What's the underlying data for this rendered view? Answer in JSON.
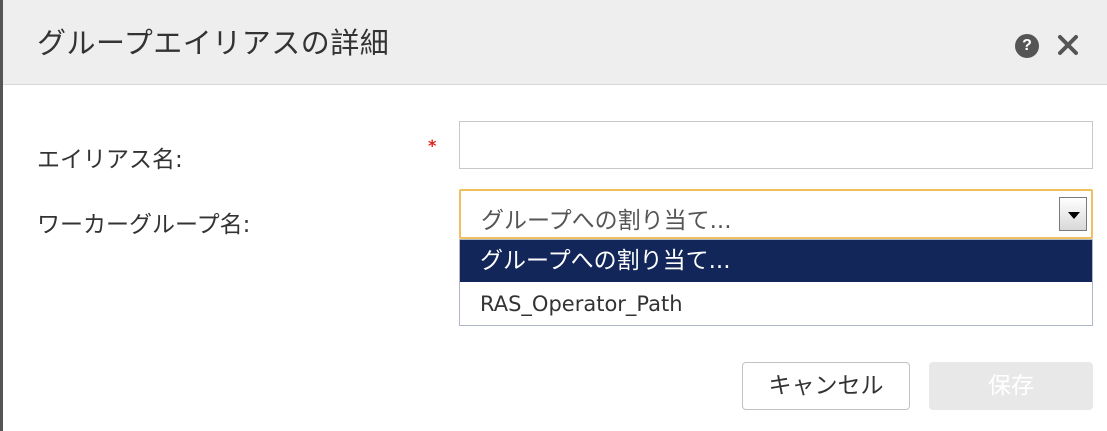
{
  "dialog": {
    "title": "グループエイリアスの詳細",
    "help_icon_glyph": "?",
    "close_icon": "close-icon"
  },
  "form": {
    "alias_label": "エイリアス名:",
    "required_marker": "*",
    "alias_value": "",
    "worker_group_label": "ワーカーグループ名:",
    "select_value": "グループへの割り当て...",
    "options": [
      "グループへの割り当て...",
      "RAS_Operator_Path"
    ]
  },
  "buttons": {
    "cancel": "キャンセル",
    "save": "保存"
  },
  "colors": {
    "header_bg": "#eeeeee",
    "selected_option_bg": "#13265a",
    "required": "#e0211a",
    "focus_border": "#f0c060"
  }
}
